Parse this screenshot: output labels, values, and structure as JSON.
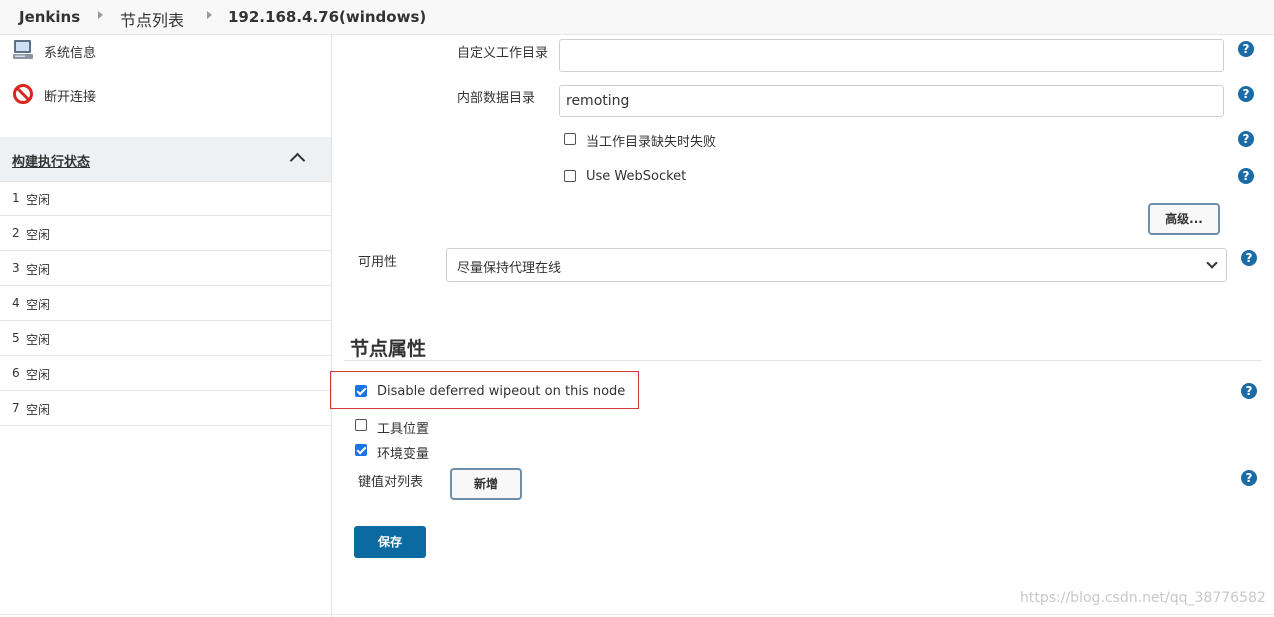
{
  "breadcrumb": {
    "items": [
      "Jenkins",
      "节点列表",
      "192.168.4.76(windows)"
    ]
  },
  "sidebar": {
    "tasks": [
      {
        "label": "系统信息",
        "icon": "computer-icon"
      },
      {
        "label": "断开连接",
        "icon": "no-entry-icon"
      }
    ],
    "executor_panel": {
      "title": "构建执行状态",
      "rows": [
        {
          "num": "1",
          "status": "空闲"
        },
        {
          "num": "2",
          "status": "空闲"
        },
        {
          "num": "3",
          "status": "空闲"
        },
        {
          "num": "4",
          "status": "空闲"
        },
        {
          "num": "5",
          "status": "空闲"
        },
        {
          "num": "6",
          "status": "空闲"
        },
        {
          "num": "7",
          "status": "空闲"
        }
      ]
    }
  },
  "form": {
    "custom_workdir": {
      "label": "自定义工作目录",
      "value": ""
    },
    "internal_data_dir": {
      "label": "内部数据目录",
      "value": "remoting"
    },
    "fail_if_workdir_missing": {
      "label": "当工作目录缺失时失败",
      "checked": false
    },
    "use_websocket": {
      "label": "Use WebSocket",
      "checked": false
    },
    "advanced_button": "高级...",
    "availability": {
      "label": "可用性",
      "value": "尽量保持代理在线"
    },
    "help_glyph": "?"
  },
  "node_properties": {
    "title": "节点属性",
    "disable_deferred_wipeout": {
      "label": "Disable deferred wipeout on this node",
      "checked": true
    },
    "tool_locations": {
      "label": "工具位置",
      "checked": false
    },
    "env_vars": {
      "label": "环境变量",
      "checked": true
    },
    "kv_list_label": "键值对列表",
    "add_button": "新增"
  },
  "save_button": "保存",
  "watermark": "https://blog.csdn.net/qq_38776582",
  "colors": {
    "accent": "#0b6aa2",
    "help": "#1a6ba6",
    "highlight_border": "#d13a3a",
    "checkbox": "#1a73e8"
  }
}
